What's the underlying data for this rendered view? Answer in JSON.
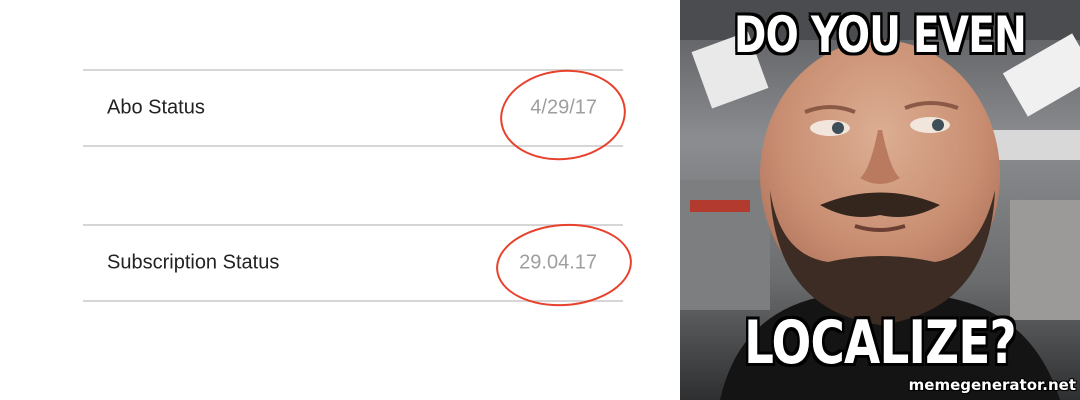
{
  "settings": {
    "rows": [
      {
        "label": "Abo Status",
        "value": "4/29/17"
      },
      {
        "label": "Subscription Status",
        "value": "29.04.17"
      }
    ],
    "highlight_color": "#e8412c"
  },
  "meme": {
    "top_text": "DO YOU EVEN",
    "bottom_text": "LOCALIZE?",
    "watermark": "memegenerator.net"
  }
}
